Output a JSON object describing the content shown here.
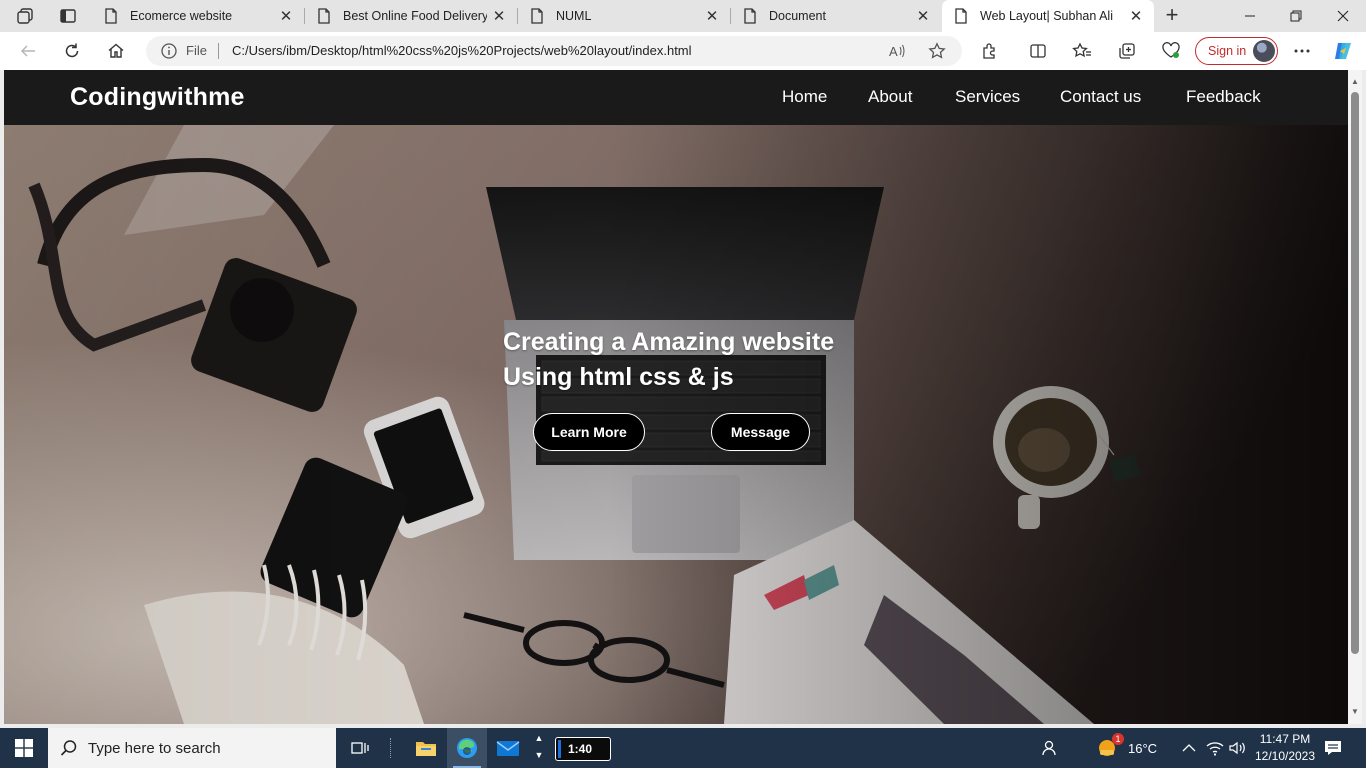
{
  "browser": {
    "tabs": [
      {
        "title": "Ecomerce website",
        "active": false
      },
      {
        "title": "Best Online Food Delivery s",
        "active": false
      },
      {
        "title": "NUML",
        "active": false
      },
      {
        "title": "Document",
        "active": false
      },
      {
        "title": "Web Layout| Subhan Ali",
        "active": true
      }
    ],
    "address": {
      "scheme_label": "File",
      "url": "C:/Users/ibm/Desktop/html%20css%20js%20Projects/web%20layout/index.html"
    },
    "signin_label": "Sign in"
  },
  "site": {
    "logo": "Codingwithme",
    "menu": [
      "Home",
      "About",
      "Services",
      "Contact us",
      "Feedback"
    ],
    "hero": {
      "line1": "Creating a Amazing website",
      "line2": "Using html css & js",
      "buttons": [
        "Learn More",
        "Message"
      ]
    }
  },
  "taskbar": {
    "search_placeholder": "Type here to search",
    "timer": "1:40",
    "weather": {
      "temp": "16°C",
      "badge": "1"
    },
    "clock": {
      "time": "11:47 PM",
      "date": "12/10/2023"
    }
  },
  "colors": {
    "signin_accent": "#c42b2b",
    "header_bg": "#1a1a1a",
    "taskbar_bg": "#1f3247"
  }
}
